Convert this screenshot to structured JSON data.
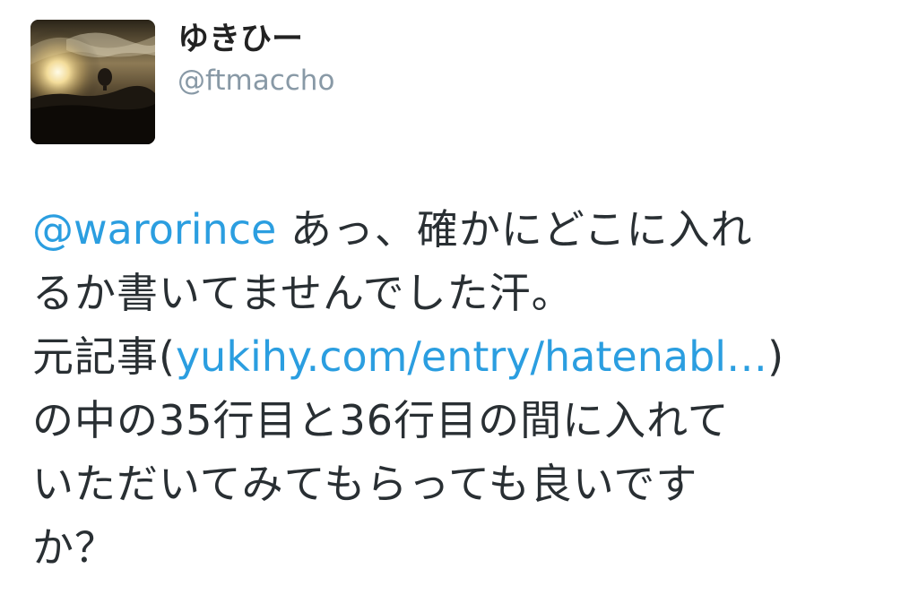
{
  "user": {
    "display_name": "ゆきひー",
    "handle": "@ftmaccho",
    "avatar_icon": "profile-photo-hot-air-balloon-sunset"
  },
  "tweet": {
    "mention": "@warorince",
    "line1_text": " あっ、確かにどこに入れ",
    "line2_text": "るか書いてませんでした汗。",
    "line3_prefix": "元記事(",
    "link_text": "yukihy.com/entry/hatenabl…",
    "line3_suffix": ")",
    "line4_text": "の中の35行目と36行目の間に入れて",
    "line5_text": "いただいてみてもらっても良いです",
    "line6_text": "か？"
  },
  "colors": {
    "link": "#2b9ee0",
    "handle": "#8899a6",
    "text": "#292f33"
  }
}
